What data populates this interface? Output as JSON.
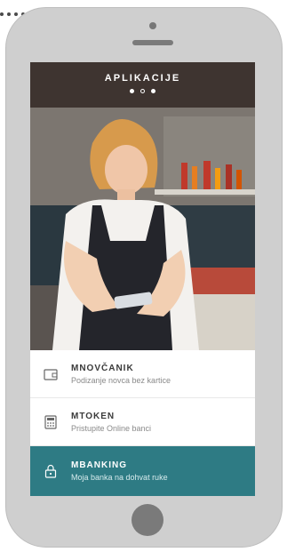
{
  "header": {
    "title": "APLIKACIJE",
    "pager": {
      "count": 3,
      "active": 2
    }
  },
  "apps": [
    {
      "title": "MNOVČANIK",
      "subtitle": "Podizanje novca bez kartice",
      "icon": "wallet-icon"
    },
    {
      "title": "MTOKEN",
      "subtitle": "Pristupite Online banci",
      "icon": "token-icon"
    },
    {
      "title": "MBANKING",
      "subtitle": "Moja banka na dohvat ruke",
      "icon": "lock-icon",
      "active": true
    }
  ],
  "colors": {
    "header": "#3e3430",
    "accent": "#2e7b84",
    "phone": "#cfcfcf"
  }
}
